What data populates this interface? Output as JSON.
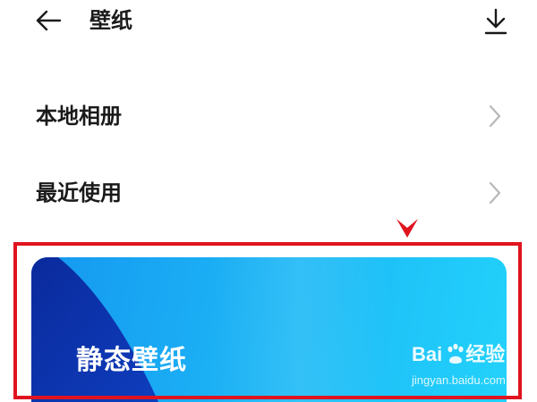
{
  "header": {
    "title": "壁纸",
    "back_icon": "back-arrow-icon",
    "download_icon": "download-icon"
  },
  "menu": {
    "items": [
      {
        "label": "本地相册",
        "icon": "chevron-right-icon"
      },
      {
        "label": "最近使用",
        "icon": "chevron-right-icon"
      }
    ]
  },
  "wallpaper_card": {
    "label": "静态壁纸"
  },
  "annotation": {
    "highlight_color": "#e0141f",
    "marker_icon": "red-down-arrow-icon"
  },
  "watermark": {
    "brand_left": "Bai",
    "brand_right": "经验",
    "url": "jingyan.baidu.com"
  },
  "colors": {
    "card_gradient_start": "#1597f0",
    "card_gradient_end": "#22d2fb",
    "card_dark_blue": "#0b2fa8",
    "title_text": "#1a1a1a"
  }
}
